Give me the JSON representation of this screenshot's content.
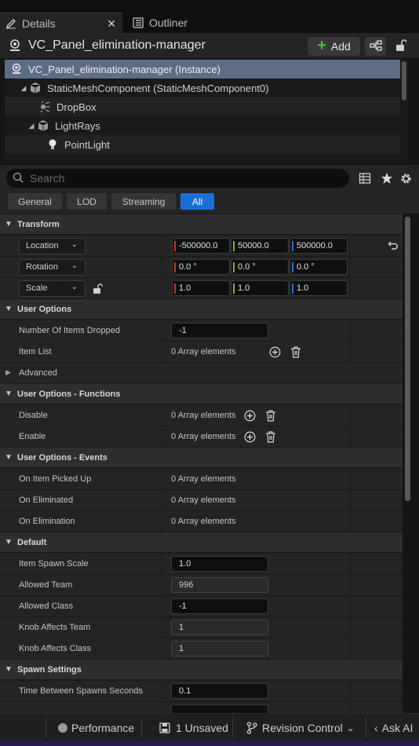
{
  "tabs": {
    "details_label": "Details",
    "outliner_label": "Outliner",
    "close_glyph": "✕"
  },
  "actor": {
    "title": "VC_Panel_elimination-manager",
    "add_label": "Add"
  },
  "tree": {
    "rows": [
      {
        "label": "VC_Panel_elimination-manager (Instance)"
      },
      {
        "label": "StaticMeshComponent (StaticMeshComponent0)"
      },
      {
        "label": "DropBox"
      },
      {
        "label": "LightRays"
      },
      {
        "label": "PointLight"
      }
    ]
  },
  "search": {
    "placeholder": "Search"
  },
  "filters": [
    "General",
    "LOD",
    "Streaming",
    "All"
  ],
  "filter_active": "All",
  "transform": {
    "header": "Transform",
    "location_label": "Location",
    "rotation_label": "Rotation",
    "scale_label": "Scale",
    "location": [
      "-500000.0",
      "50000.0",
      "500000.0"
    ],
    "rotation": [
      "0.0 °",
      "0.0 °",
      "0.0 °"
    ],
    "scale": [
      "1.0",
      "1.0",
      "1.0"
    ]
  },
  "user_options": {
    "header": "User Options",
    "items_dropped_label": "Number Of Items Dropped",
    "items_dropped_value": "-1",
    "item_list_label": "Item List",
    "item_list_value": "0 Array elements",
    "advanced_label": "Advanced"
  },
  "functions": {
    "header": "User Options - Functions",
    "disable_label": "Disable",
    "disable_value": "0 Array elements",
    "enable_label": "Enable",
    "enable_value": "0 Array elements"
  },
  "events": {
    "header": "User Options - Events",
    "picked_up_label": "On Item Picked Up",
    "picked_up_value": "0 Array elements",
    "eliminated_label": "On Eliminated",
    "eliminated_value": "0 Array elements",
    "elimination_label": "On Elimination",
    "elimination_value": "0 Array elements"
  },
  "default": {
    "header": "Default",
    "spawn_scale_label": "Item Spawn Scale",
    "spawn_scale_value": "1.0",
    "allowed_team_label": "Allowed Team",
    "allowed_team_value": "996",
    "allowed_class_label": "Allowed Class",
    "allowed_class_value": "-1",
    "knob_team_label": "Knob Affects Team",
    "knob_team_value": "1",
    "knob_class_label": "Knob Affects Class",
    "knob_class_value": "1"
  },
  "spawn": {
    "header": "Spawn Settings",
    "between_label": "Time Between Spawns Seconds",
    "between_value": "0.1"
  },
  "statusbar": {
    "performance": "Performance",
    "unsaved": "1 Unsaved",
    "revision": "Revision Control",
    "ask_ai": "Ask AI"
  },
  "colors": {
    "axis_x": "#c0382e",
    "axis_y": "#7bb32e",
    "axis_z": "#2f6fd6",
    "accent": "#1a6fd6",
    "add_plus": "#4fbf3d",
    "selection": "#5b6e86"
  }
}
